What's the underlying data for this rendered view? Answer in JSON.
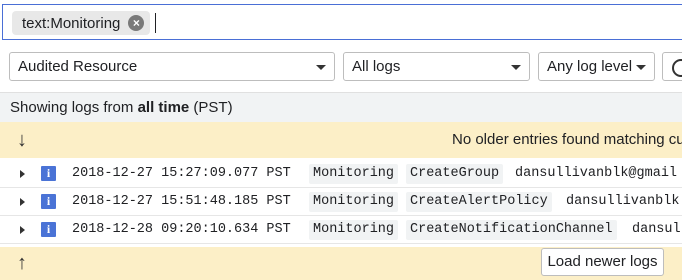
{
  "search": {
    "chip_label": "text:Monitoring",
    "chip_close_glyph": "×"
  },
  "filters": {
    "resource": "Audited Resource",
    "logs": "All logs",
    "level": "Any log level"
  },
  "status": {
    "prefix": "Showing logs from ",
    "range": "all time",
    "timezone": " (PST)"
  },
  "older_banner": {
    "message": "No older entries found matching curr"
  },
  "load_newer": {
    "label": "Load newer logs"
  },
  "severity_letter": "i",
  "rows": [
    {
      "timestamp": "2018-12-27 15:27:09.077 PST",
      "service": "Monitoring",
      "method": "CreateGroup",
      "user": "dansullivanblk@gmail"
    },
    {
      "timestamp": "2018-12-27 15:51:48.185 PST",
      "service": "Monitoring",
      "method": "CreateAlertPolicy",
      "user": "dansullivanblk"
    },
    {
      "timestamp": "2018-12-28 09:20:10.634 PST",
      "service": "Monitoring",
      "method": "CreateNotificationChannel",
      "user": "dansul"
    }
  ],
  "colors": {
    "accent": "#4a6fd6",
    "severity_info": "#4a73d6",
    "banner_yellow": "#fcefc7"
  }
}
